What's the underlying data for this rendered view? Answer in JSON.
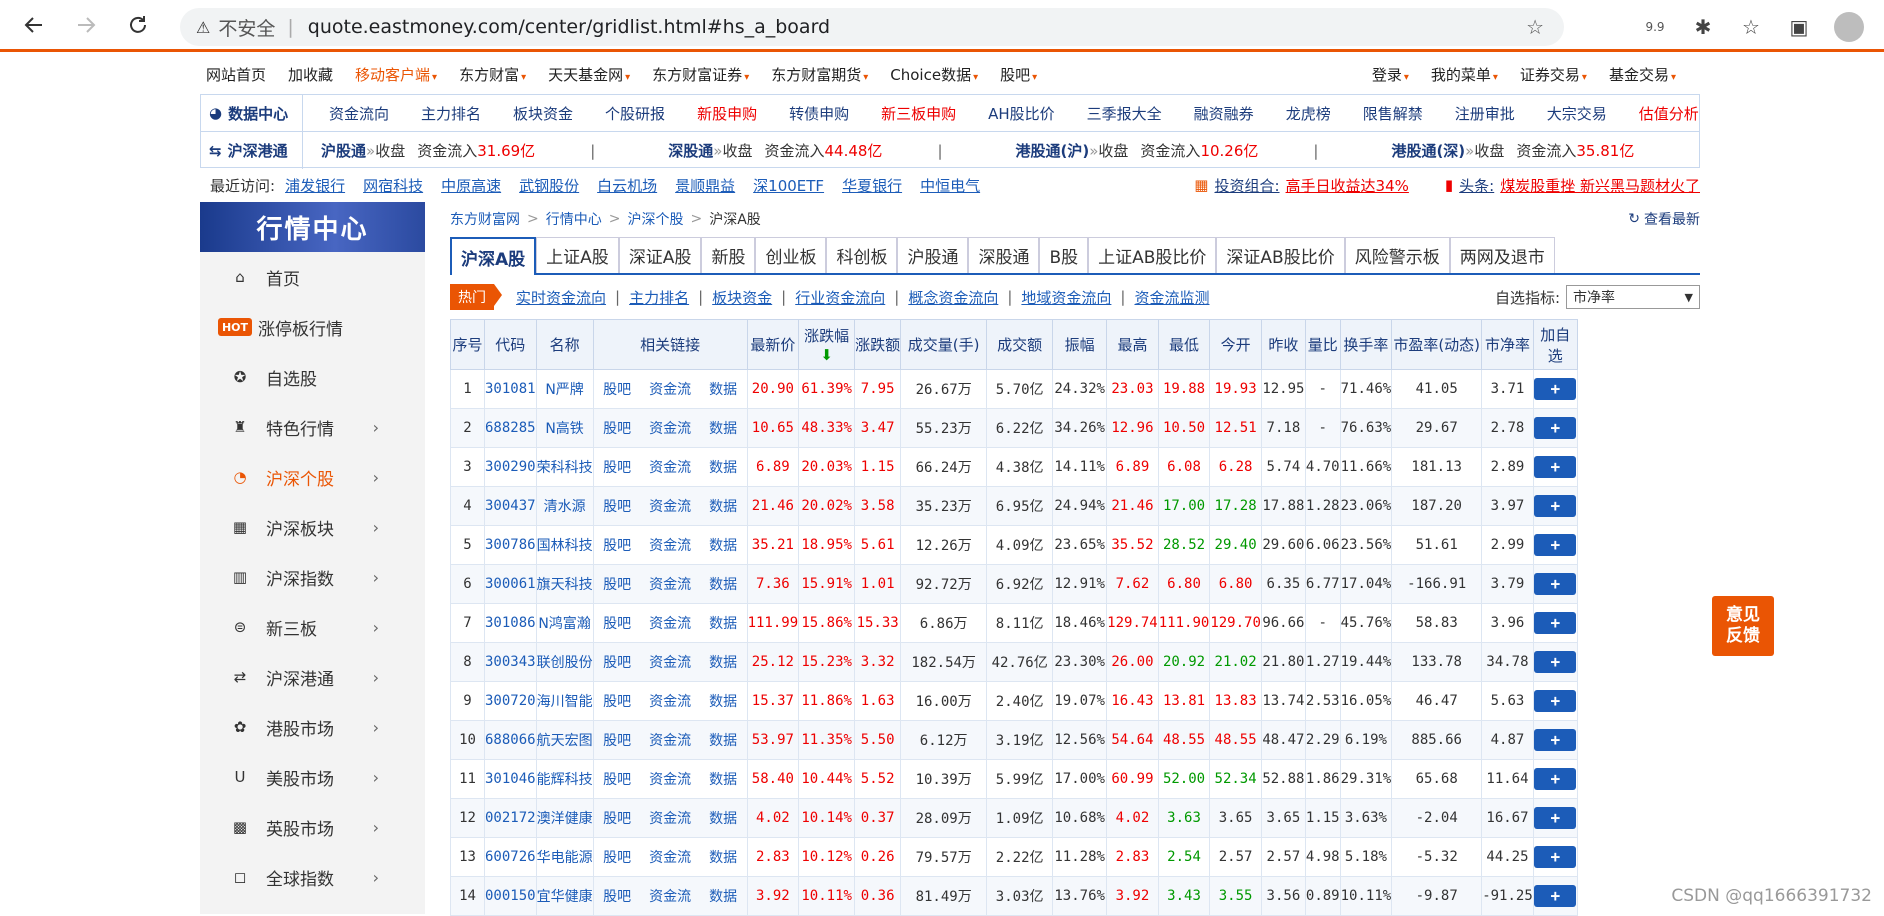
{
  "browser": {
    "insecure_label": "不安全",
    "url": "quote.eastmoney.com/center/gridlist.html#hs_a_board",
    "zoom": "9.9"
  },
  "topnav": {
    "items": [
      {
        "label": "网站首页",
        "orange": false,
        "caret": false
      },
      {
        "label": "加收藏",
        "orange": false,
        "caret": false
      },
      {
        "label": "移动客户端",
        "orange": true,
        "caret": true
      },
      {
        "label": "东方财富",
        "orange": false,
        "caret": true
      },
      {
        "label": "天天基金网",
        "orange": false,
        "caret": true
      },
      {
        "label": "东方财富证券",
        "orange": false,
        "caret": true
      },
      {
        "label": "东方财富期货",
        "orange": false,
        "caret": true
      },
      {
        "label": "Choice数据",
        "orange": false,
        "caret": true
      },
      {
        "label": "股吧",
        "orange": false,
        "caret": true
      }
    ],
    "right_items": [
      "登录",
      "我的菜单",
      "证券交易",
      "基金交易"
    ]
  },
  "datacenter": {
    "label": "数据中心",
    "links": [
      {
        "t": "资金流向",
        "red": false
      },
      {
        "t": "主力排名",
        "red": false
      },
      {
        "t": "板块资金",
        "red": false
      },
      {
        "t": "个股研报",
        "red": false
      },
      {
        "t": "新股申购",
        "red": true
      },
      {
        "t": "转债申购",
        "red": false
      },
      {
        "t": "新三板申购",
        "red": true
      },
      {
        "t": "AH股比价",
        "red": false
      },
      {
        "t": "三季报大全",
        "red": false
      },
      {
        "t": "融资融券",
        "red": false
      },
      {
        "t": "龙虎榜",
        "red": false
      },
      {
        "t": "限售解禁",
        "red": false
      },
      {
        "t": "注册审批",
        "red": false
      },
      {
        "t": "大宗交易",
        "red": false
      },
      {
        "t": "估值分析",
        "red": true
      }
    ],
    "hk_label": "沪深港通",
    "flows": [
      {
        "name": "沪股通",
        "status": "收盘",
        "prefix": "资金流入",
        "val": "31.69亿"
      },
      {
        "name": "深股通",
        "status": "收盘",
        "prefix": "资金流入",
        "val": "44.48亿"
      },
      {
        "name": "港股通(沪)",
        "status": "收盘",
        "prefix": "资金流入",
        "val": "10.26亿"
      },
      {
        "name": "港股通(深)",
        "status": "收盘",
        "prefix": "资金流入",
        "val": "35.81亿"
      }
    ]
  },
  "recent": {
    "label": "最近访问:",
    "items": [
      "浦发银行",
      "网宿科技",
      "中原高速",
      "武钢股份",
      "白云机场",
      "景顺鼎益",
      "深100ETF",
      "华夏银行",
      "中恒电气"
    ],
    "portfolio_label": "投资组合:",
    "portfolio_text": "高手日收益达34%",
    "headline_label": "头条:",
    "headline_text": "煤炭股重挫  新兴黑马题材火了"
  },
  "sidebar": {
    "title": "行情中心",
    "items": [
      {
        "label": "首页",
        "icon": "⌂",
        "arrow": false,
        "hot": false,
        "active": false
      },
      {
        "label": "涨停板行情",
        "icon": "",
        "arrow": false,
        "hot": true,
        "active": false
      },
      {
        "label": "自选股",
        "icon": "✪",
        "arrow": false,
        "hot": false,
        "active": false
      },
      {
        "label": "特色行情",
        "icon": "♜",
        "arrow": true,
        "hot": false,
        "active": false
      },
      {
        "label": "沪深个股",
        "icon": "◔",
        "arrow": true,
        "hot": false,
        "active": true
      },
      {
        "label": "沪深板块",
        "icon": "▦",
        "arrow": true,
        "hot": false,
        "active": false
      },
      {
        "label": "沪深指数",
        "icon": "▥",
        "arrow": true,
        "hot": false,
        "active": false
      },
      {
        "label": "新三板",
        "icon": "⊜",
        "arrow": true,
        "hot": false,
        "active": false
      },
      {
        "label": "沪深港通",
        "icon": "⇄",
        "arrow": true,
        "hot": false,
        "active": false
      },
      {
        "label": "港股市场",
        "icon": "✿",
        "arrow": true,
        "hot": false,
        "active": false
      },
      {
        "label": "美股市场",
        "icon": "U",
        "arrow": true,
        "hot": false,
        "active": false
      },
      {
        "label": "英股市场",
        "icon": "▩",
        "arrow": true,
        "hot": false,
        "active": false
      },
      {
        "label": "全球指数",
        "icon": "◻",
        "arrow": true,
        "hot": false,
        "active": false
      }
    ],
    "hot_badge": "HOT"
  },
  "breadcrumb": [
    "东方财富网",
    "行情中心",
    "沪深个股",
    "沪深A股"
  ],
  "refresh_label": "查看最新",
  "tabs": [
    "沪深A股",
    "上证A股",
    "深证A股",
    "新股",
    "创业板",
    "科创板",
    "沪股通",
    "深股通",
    "B股",
    "上证AB股比价",
    "深证AB股比价",
    "风险警示板",
    "两网及退市"
  ],
  "subbar": {
    "hot": "热门",
    "links": [
      "实时资金流向",
      "主力排名",
      "板块资金",
      "行业资金流向",
      "概念资金流向",
      "地域资金流向",
      "资金流监测"
    ],
    "indicator_label": "自选指标:",
    "indicator_value": "市净率"
  },
  "table": {
    "headers": [
      "序号",
      "代码",
      "名称",
      "相关链接",
      "最新价",
      "涨跌幅",
      "涨跌额",
      "成交量(手)",
      "成交额",
      "振幅",
      "最高",
      "最低",
      "今开",
      "昨收",
      "量比",
      "换手率",
      "市盈率(动态)",
      "市净率",
      "加自选"
    ],
    "link_labels": [
      "股吧",
      "资金流",
      "数据"
    ],
    "rows": [
      [
        "1",
        "301081",
        "N严牌",
        "20.90",
        "61.39%",
        "7.95",
        "26.67万",
        "5.70亿",
        "24.32%",
        "23.03",
        "19.88",
        "19.93",
        "12.95",
        "-",
        "71.46%",
        "41.05",
        "3.71"
      ],
      [
        "2",
        "688285",
        "N高铁",
        "10.65",
        "48.33%",
        "3.47",
        "55.23万",
        "6.22亿",
        "34.26%",
        "12.96",
        "10.50",
        "12.51",
        "7.18",
        "-",
        "76.63%",
        "29.67",
        "2.78"
      ],
      [
        "3",
        "300290",
        "荣科科技",
        "6.89",
        "20.03%",
        "1.15",
        "66.24万",
        "4.38亿",
        "14.11%",
        "6.89",
        "6.08",
        "6.28",
        "5.74",
        "4.70",
        "11.66%",
        "181.13",
        "2.89"
      ],
      [
        "4",
        "300437",
        "清水源",
        "21.46",
        "20.02%",
        "3.58",
        "35.23万",
        "6.95亿",
        "24.94%",
        "21.46",
        "17.00",
        "17.28",
        "17.88",
        "1.28",
        "23.06%",
        "187.20",
        "3.97"
      ],
      [
        "5",
        "300786",
        "国林科技",
        "35.21",
        "18.95%",
        "5.61",
        "12.26万",
        "4.09亿",
        "23.65%",
        "35.52",
        "28.52",
        "29.40",
        "29.60",
        "6.06",
        "23.56%",
        "51.61",
        "2.99"
      ],
      [
        "6",
        "300061",
        "旗天科技",
        "7.36",
        "15.91%",
        "1.01",
        "92.72万",
        "6.92亿",
        "12.91%",
        "7.62",
        "6.80",
        "6.80",
        "6.35",
        "6.77",
        "17.04%",
        "-166.91",
        "3.79"
      ],
      [
        "7",
        "301086",
        "N鸿富瀚",
        "111.99",
        "15.86%",
        "15.33",
        "6.86万",
        "8.11亿",
        "18.46%",
        "129.74",
        "111.90",
        "129.70",
        "96.66",
        "-",
        "45.76%",
        "58.83",
        "3.96"
      ],
      [
        "8",
        "300343",
        "联创股份",
        "25.12",
        "15.23%",
        "3.32",
        "182.54万",
        "42.76亿",
        "23.30%",
        "26.00",
        "20.92",
        "21.02",
        "21.80",
        "1.27",
        "19.44%",
        "133.78",
        "34.78"
      ],
      [
        "9",
        "300720",
        "海川智能",
        "15.37",
        "11.86%",
        "1.63",
        "16.00万",
        "2.40亿",
        "19.07%",
        "16.43",
        "13.81",
        "13.83",
        "13.74",
        "2.53",
        "16.05%",
        "46.47",
        "5.63"
      ],
      [
        "10",
        "688066",
        "航天宏图",
        "53.97",
        "11.35%",
        "5.50",
        "6.12万",
        "3.19亿",
        "12.56%",
        "54.64",
        "48.55",
        "48.55",
        "48.47",
        "2.29",
        "6.19%",
        "885.66",
        "4.87"
      ],
      [
        "11",
        "301046",
        "能辉科技",
        "58.40",
        "10.44%",
        "5.52",
        "10.39万",
        "5.99亿",
        "17.00%",
        "60.99",
        "52.00",
        "52.34",
        "52.88",
        "1.86",
        "29.31%",
        "65.68",
        "11.64"
      ],
      [
        "12",
        "002172",
        "澳洋健康",
        "4.02",
        "10.14%",
        "0.37",
        "28.09万",
        "1.09亿",
        "10.68%",
        "4.02",
        "3.63",
        "3.65",
        "3.65",
        "1.15",
        "3.63%",
        "-2.04",
        "16.67"
      ],
      [
        "13",
        "600726",
        "华电能源",
        "2.83",
        "10.12%",
        "0.26",
        "79.57万",
        "2.22亿",
        "11.28%",
        "2.83",
        "2.54",
        "2.57",
        "2.57",
        "4.98",
        "5.18%",
        "-5.32",
        "44.25"
      ],
      [
        "14",
        "000150",
        "宜华健康",
        "3.92",
        "10.11%",
        "0.36",
        "81.49万",
        "3.03亿",
        "13.76%",
        "3.92",
        "3.43",
        "3.55",
        "3.56",
        "0.89",
        "10.11%",
        "-9.87",
        "-91.25"
      ]
    ],
    "high_colors": [
      "red",
      "red",
      "red",
      "red",
      "red",
      "red",
      "red",
      "red",
      "red",
      "red",
      "red",
      "red",
      "red",
      "red"
    ],
    "low_colors": [
      "red",
      "red",
      "red",
      "green",
      "green",
      "red",
      "red",
      "green",
      "red",
      "red",
      "green",
      "green",
      "green",
      "green"
    ],
    "open_colors": [
      "red",
      "red",
      "red",
      "green",
      "green",
      "red",
      "red",
      "green",
      "red",
      "red",
      "green",
      "black",
      "black",
      "green"
    ]
  },
  "feedback": [
    "意见",
    "反馈"
  ],
  "watermark": "CSDN @qq1666391732"
}
